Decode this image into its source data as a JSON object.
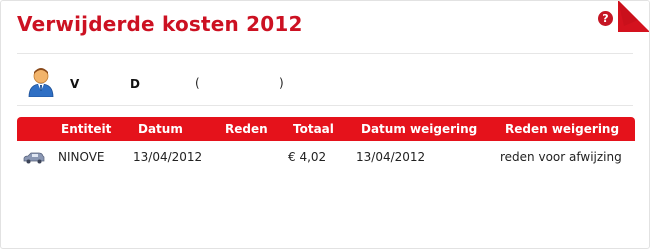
{
  "header": {
    "title": "Verwijderde kosten 2012",
    "help_label": "?"
  },
  "user": {
    "first": "V",
    "last": "D",
    "paren_open": "(",
    "paren_close": ")"
  },
  "table": {
    "columns": [
      "Entiteit",
      "Datum",
      "Reden",
      "Totaal",
      "Datum weigering",
      "Reden weigering"
    ],
    "rows": [
      {
        "icon": "car-icon",
        "entiteit": "NINOVE",
        "datum": "13/04/2012",
        "reden": "",
        "totaal": "€ 4,02",
        "datum_weigering": "13/04/2012",
        "reden_weigering": "reden voor afwijzing"
      }
    ]
  },
  "colors": {
    "title": "#cc1122",
    "header_bar": "#e5121b",
    "help_icon": "#c51624"
  }
}
